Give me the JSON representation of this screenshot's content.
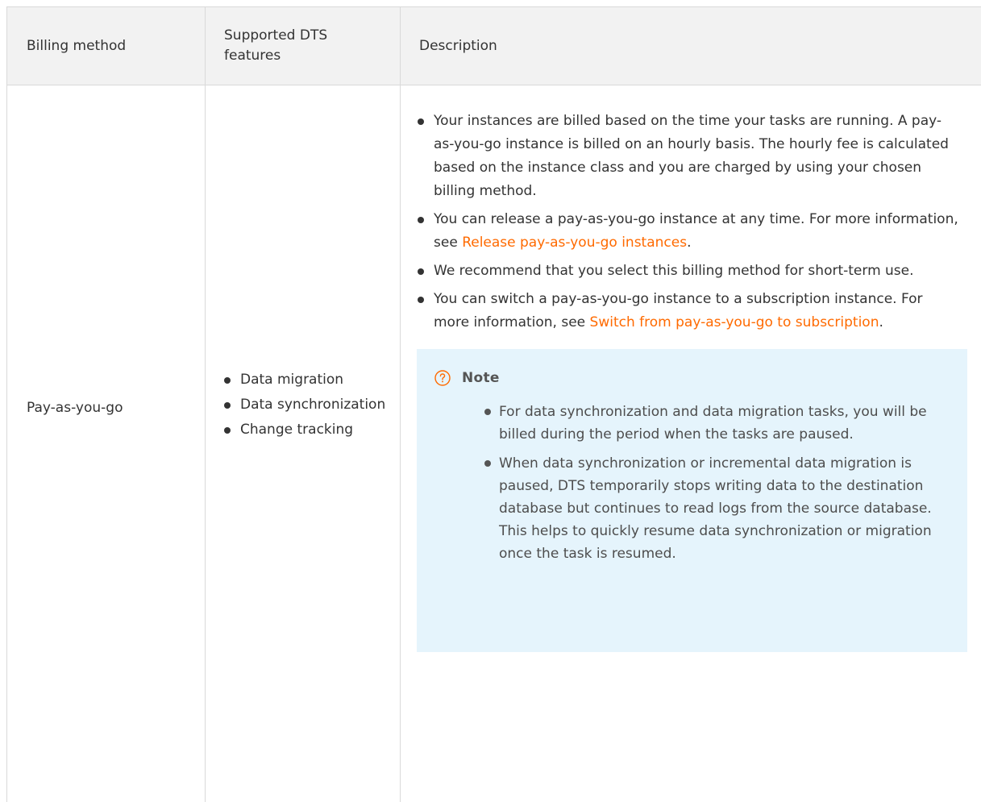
{
  "table": {
    "headers": {
      "billing_method": "Billing method",
      "supported_features": "Supported DTS features",
      "description": "Description"
    },
    "row": {
      "billing_method": "Pay-as-you-go",
      "features": [
        "Data migration",
        "Data synchronization",
        "Change tracking"
      ],
      "description": {
        "item1": "Your instances are billed based on the time your tasks are running. A pay-as-you-go instance is billed on an hourly basis. The hourly fee is calculated based on the instance class and you are charged by using your chosen billing method.",
        "item2_text": "You can release a pay-as-you-go instance at any time. For more information, see ",
        "item2_link": "Release pay-as-you-go instances",
        "item2_suffix": ".",
        "item3": "We recommend that you select this billing method for short-term use.",
        "item4_text": "You can switch a pay-as-you-go instance to a subscription instance. For more information, see ",
        "item4_link": "Switch from pay-as-you-go to subscription",
        "item4_suffix": "."
      },
      "note": {
        "title": "Note",
        "icon": "question-circle-icon",
        "items": [
          "For data synchronization and data migration tasks, you will be billed during the period when the tasks are paused.",
          "When data synchronization or incremental data migration is paused, DTS temporarily stops writing data to the destination database but continues to read logs from the source database. This helps to quickly resume data synchronization or migration once the task is resumed."
        ]
      }
    }
  },
  "colors": {
    "link": "#ff6a00",
    "header_bg": "#f2f2f2",
    "border": "#d9d9d9",
    "note_bg": "#e5f4fc",
    "note_icon": "#ff6a00"
  }
}
